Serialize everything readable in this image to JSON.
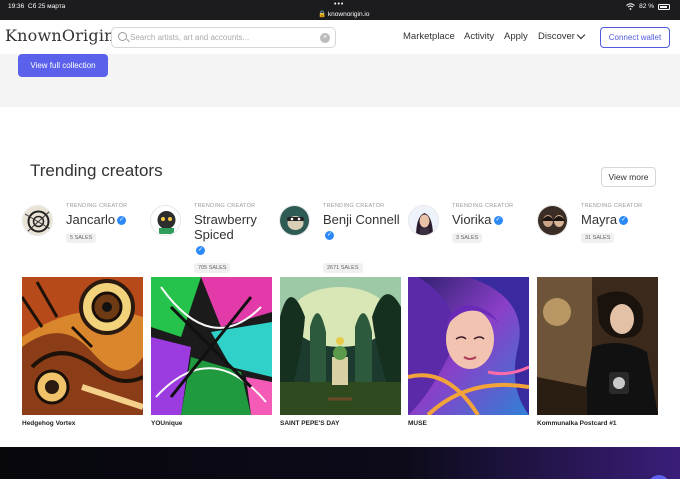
{
  "status_bar": {
    "time": "19:36",
    "date": "Сб 25 марта",
    "url": "knownorigin.io",
    "battery": "82 %",
    "dots": "•••"
  },
  "nav": {
    "logo": "KnownOrigin.",
    "search": {
      "placeholder": "Search artists, art and accounts...",
      "value": ""
    },
    "links": [
      "Marketplace",
      "Activity",
      "Apply",
      "Discover"
    ],
    "connect_label": "Connect wallet"
  },
  "collection": {
    "view_full_label": "View full collection"
  },
  "trending": {
    "title": "Trending creators",
    "view_more_label": "View more",
    "tag": "TRENDING CREATOR",
    "creators": [
      {
        "name": "Jancarlo",
        "sales": "5 SALES"
      },
      {
        "name": "Strawberry Spiced",
        "sales": "705 SALES"
      },
      {
        "name": "Benji Connell",
        "sales": "2671 SALES"
      },
      {
        "name": "Viorika",
        "sales": "3 SALES"
      },
      {
        "name": "Mayra",
        "sales": "31 SALES"
      }
    ],
    "artworks": [
      {
        "title": "Hedgehog Vortex"
      },
      {
        "title": "YOUnique"
      },
      {
        "title": "SAINT PEPE'S DAY"
      },
      {
        "title": "MUSE"
      },
      {
        "title": "Kommunalka Postcard #1"
      }
    ]
  },
  "colors": {
    "accent": "#5b61ea",
    "verified": "#2b8af7",
    "gray_section": "#f4f4f5"
  },
  "icons": [
    "search-icon",
    "clear-icon",
    "chevron-down-icon",
    "verified-icon",
    "wifi-icon",
    "battery-icon",
    "lock-icon"
  ]
}
